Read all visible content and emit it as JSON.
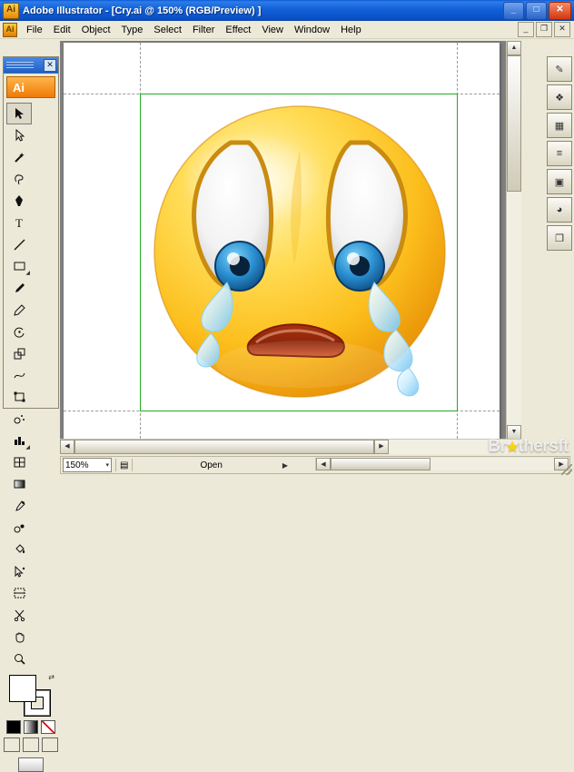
{
  "window": {
    "title": "Adobe Illustrator - [Cry.ai @ 150% (RGB/Preview) ]",
    "app_icon": "illustrator-icon",
    "buttons": {
      "minimize": "_",
      "maximize": "□",
      "close": "✕"
    }
  },
  "menubar": {
    "doc_icon": "document-icon",
    "items": [
      {
        "label": "File"
      },
      {
        "label": "Edit"
      },
      {
        "label": "Object"
      },
      {
        "label": "Type"
      },
      {
        "label": "Select"
      },
      {
        "label": "Filter"
      },
      {
        "label": "Effect"
      },
      {
        "label": "View"
      },
      {
        "label": "Window"
      },
      {
        "label": "Help"
      }
    ],
    "doc_buttons": {
      "minimize": "_",
      "restore": "❐",
      "close": "✕"
    }
  },
  "toolbox": {
    "title_close": "✕",
    "logo": "Ai",
    "tools": [
      {
        "name": "selection-tool",
        "glyph": "selection"
      },
      {
        "name": "direct-selection-tool",
        "glyph": "direct-selection"
      },
      {
        "name": "magic-wand-tool",
        "glyph": "magic-wand"
      },
      {
        "name": "lasso-tool",
        "glyph": "lasso"
      },
      {
        "name": "pen-tool",
        "glyph": "pen"
      },
      {
        "name": "type-tool",
        "glyph": "T"
      },
      {
        "name": "line-segment-tool",
        "glyph": "line"
      },
      {
        "name": "rectangle-tool",
        "glyph": "rectangle"
      },
      {
        "name": "paintbrush-tool",
        "glyph": "paintbrush"
      },
      {
        "name": "pencil-tool",
        "glyph": "pencil"
      },
      {
        "name": "rotate-tool",
        "glyph": "rotate"
      },
      {
        "name": "scale-tool",
        "glyph": "scale"
      },
      {
        "name": "warp-tool",
        "glyph": "warp"
      },
      {
        "name": "free-transform-tool",
        "glyph": "free-transform"
      },
      {
        "name": "symbol-sprayer-tool",
        "glyph": "symbol-sprayer"
      },
      {
        "name": "column-graph-tool",
        "glyph": "column-graph"
      },
      {
        "name": "mesh-tool",
        "glyph": "mesh"
      },
      {
        "name": "gradient-tool",
        "glyph": "gradient"
      },
      {
        "name": "eyedropper-tool",
        "glyph": "eyedropper"
      },
      {
        "name": "blend-tool",
        "glyph": "blend"
      },
      {
        "name": "live-paint-bucket-tool",
        "glyph": "paint-bucket"
      },
      {
        "name": "live-paint-selection-tool",
        "glyph": "paint-selection"
      },
      {
        "name": "slice-tool",
        "glyph": "slice"
      },
      {
        "name": "scissors-tool",
        "glyph": "scissors"
      },
      {
        "name": "hand-tool",
        "glyph": "hand"
      },
      {
        "name": "zoom-tool",
        "glyph": "zoom"
      }
    ],
    "fill_color": "#ffffff",
    "stroke_color": "#ffffff",
    "swatch_mini": "⇄",
    "paint_modes": [
      "normal-fill",
      "gradient-fill",
      "none-fill"
    ],
    "screen_modes": [
      "standard-screen-mode",
      "full-screen-menubar",
      "full-screen"
    ]
  },
  "document": {
    "artboard_border_color": "#22aa22",
    "artwork": "crying-face-emoticon",
    "page_background": "#ffffff",
    "canvas_background": "#808080"
  },
  "rightdock": {
    "buttons": [
      {
        "name": "brushes-panel",
        "glyph": "✎"
      },
      {
        "name": "symbols-panel",
        "glyph": "❖"
      },
      {
        "name": "swatches-panel",
        "glyph": "▦"
      },
      {
        "name": "align-panel",
        "glyph": "≡"
      },
      {
        "name": "transparency-panel",
        "glyph": "▣"
      },
      {
        "name": "appearance-panel",
        "glyph": "◕"
      },
      {
        "name": "layers-panel",
        "glyph": "❐"
      }
    ]
  },
  "statusbar": {
    "zoom": "150%",
    "zoom_arrow": "▾",
    "doc_icon": "page-icon",
    "status_text": "Open",
    "status_arrow": "▶"
  },
  "watermark": {
    "text_1": "Br",
    "star": "★",
    "text_2": "thers",
    "text_3": "ft"
  }
}
